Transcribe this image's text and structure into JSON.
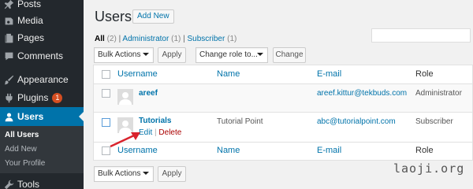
{
  "sidebar": {
    "items": [
      {
        "label": "Posts",
        "icon": "pin-icon"
      },
      {
        "label": "Media",
        "icon": "media-icon"
      },
      {
        "label": "Pages",
        "icon": "pages-icon"
      },
      {
        "label": "Comments",
        "icon": "comments-icon"
      },
      {
        "label": "Appearance",
        "icon": "brush-icon"
      },
      {
        "label": "Plugins",
        "icon": "plugin-icon",
        "badge": "1"
      },
      {
        "label": "Users",
        "icon": "user-icon",
        "current": true
      },
      {
        "label": "Tools",
        "icon": "wrench-icon"
      }
    ],
    "submenu": [
      "All Users",
      "Add New",
      "Your Profile"
    ]
  },
  "header": {
    "title": "Users",
    "add_new": "Add New"
  },
  "filters": {
    "all": "All",
    "all_count": "(2)",
    "sep": "|",
    "administrator": "Administrator",
    "administrator_count": "(1)",
    "subscriber": "Subscriber",
    "subscriber_count": "(1)"
  },
  "toolbar": {
    "bulk_actions": "Bulk Actions",
    "apply": "Apply",
    "change_role": "Change role to...",
    "change": "Change"
  },
  "table": {
    "columns": [
      "Username",
      "Name",
      "E-mail",
      "Role"
    ],
    "rows": [
      {
        "username": "areef",
        "name": "",
        "email": "areef.kittur@tekbuds.com",
        "role": "Administrator"
      },
      {
        "username": "Tutorials",
        "name": "Tutorial Point",
        "email": "abc@tutorialpoint.com",
        "role": "Subscriber",
        "actions": [
          "Edit",
          "Delete"
        ]
      }
    ]
  },
  "bottom_toolbar": {
    "bulk_actions": "Bulk Actions",
    "apply": "Apply"
  },
  "watermark": "laoji.org",
  "colors": {
    "sidebar_bg": "#23282d",
    "accent": "#0073aa",
    "badge": "#d54e21",
    "delete": "#aa0000",
    "arrow": "#d9232d"
  }
}
